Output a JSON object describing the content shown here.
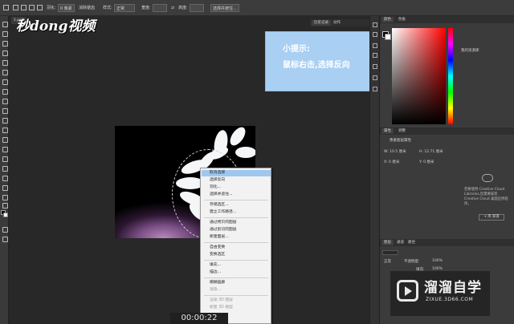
{
  "options_bar": {
    "mode_label": "羽化:",
    "feather_value": "0 像素",
    "antialias_label": "消除锯齿",
    "style_label": "样式:",
    "style_value": "正常",
    "width_label": "宽度:",
    "height_label": "高度:",
    "refine_button": "选择并遮住..."
  },
  "document": {
    "tab_title": "1.psd"
  },
  "logo": {
    "text": "秒dong视频"
  },
  "tip": {
    "title": "小提示:",
    "body": "鼠标右击,选择反向"
  },
  "context_menu": {
    "items": [
      {
        "label": "取消选择",
        "highlighted": true,
        "disabled": false
      },
      {
        "label": "选择反向",
        "highlighted": false,
        "disabled": false
      },
      {
        "label": "羽化...",
        "highlighted": false,
        "disabled": false
      },
      {
        "label": "选择并遮住...",
        "highlighted": false,
        "disabled": false
      },
      {
        "label": "存储选区...",
        "highlighted": false,
        "disabled": false
      },
      {
        "label": "建立工作路径...",
        "highlighted": false,
        "disabled": false
      },
      {
        "label": "通过拷贝的图层",
        "highlighted": false,
        "disabled": false
      },
      {
        "label": "通过剪切的图层",
        "highlighted": false,
        "disabled": false
      },
      {
        "label": "新建图层...",
        "highlighted": false,
        "disabled": false
      },
      {
        "label": "自由变换",
        "highlighted": false,
        "disabled": false
      },
      {
        "label": "变换选区",
        "highlighted": false,
        "disabled": false
      },
      {
        "label": "填充...",
        "highlighted": false,
        "disabled": false
      },
      {
        "label": "描边...",
        "highlighted": false,
        "disabled": false
      },
      {
        "label": "模糊画廊",
        "highlighted": false,
        "disabled": false
      },
      {
        "label": "渐隐...",
        "highlighted": false,
        "disabled": true
      },
      {
        "label": "渲染 3D 图层",
        "highlighted": false,
        "disabled": true
      },
      {
        "label": "新建 3D 模型",
        "highlighted": false,
        "disabled": true
      }
    ]
  },
  "timer": {
    "text": "00:00:22"
  },
  "right_panel": {
    "top_tabs": [
      "颜色",
      "色板"
    ],
    "history_tabs": [
      "历史记录",
      "动作"
    ],
    "libraries_title": "我的资源库",
    "properties_tabs": [
      "属性",
      "调整"
    ],
    "properties_title": "像素图层属性",
    "width_field": "W: 10.5 厘米",
    "height_field": "H: 12.71 厘米",
    "x_field": "X: 0 厘米",
    "y_field": "Y: 0 厘米",
    "libraries_note": "若要使用 Creative Cloud Libraries,您需要安装 Creative Cloud 桌面应用程序。",
    "libraries_button": "+ 库 获得",
    "layers_tabs": [
      "图层",
      "通道",
      "路径"
    ],
    "blend_mode": "正常",
    "opacity_label": "不透明度:",
    "opacity_value": "100%",
    "fill_label": "填充:",
    "fill_value": "100%"
  },
  "watermark": {
    "title": "溜溜自学",
    "url": "ZIXUE.3D66.COM"
  }
}
